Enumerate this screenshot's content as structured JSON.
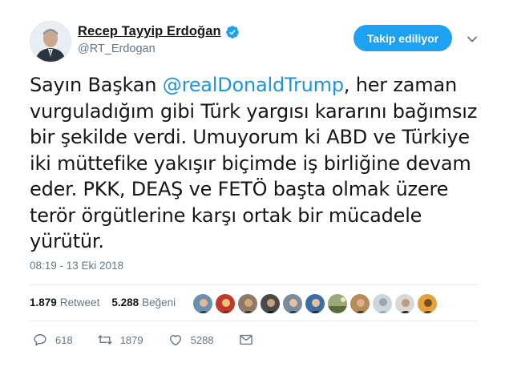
{
  "user": {
    "display_name": "Recep Tayyip Erdoğan",
    "handle": "@RT_Erdogan",
    "follow_label": "Takip ediliyor"
  },
  "tweet": {
    "text_before": "Sayın Başkan ",
    "mention": "@realDonaldTrump",
    "text_after": ", her zaman vurguladığım gibi Türk yargısı kararını bağımsız bir şekilde verdi. Umuyorum ki ABD ve Türkiye iki müttefike yakışır biçimde iş birliğine devam eder. PKK, DEAŞ ve FETÖ başta olmak üzere terör örgütlerine karşı ortak bir mücadele yürütür.",
    "timestamp": "08:19 - 13 Eki 2018"
  },
  "stats": {
    "retweet_count": "1.879",
    "retweet_label": "Retweet",
    "like_count": "5.288",
    "like_label": "Beğeni"
  },
  "actions": {
    "reply_count": "618",
    "retweet_count": "1879",
    "like_count": "5288"
  },
  "colors": {
    "accent": "#1da1f2",
    "mention": "#1b95e0",
    "muted": "#657786"
  },
  "icons": [
    "verified-badge-icon",
    "chevron-down-icon",
    "reply-icon",
    "retweet-icon",
    "like-icon",
    "direct-message-icon"
  ]
}
